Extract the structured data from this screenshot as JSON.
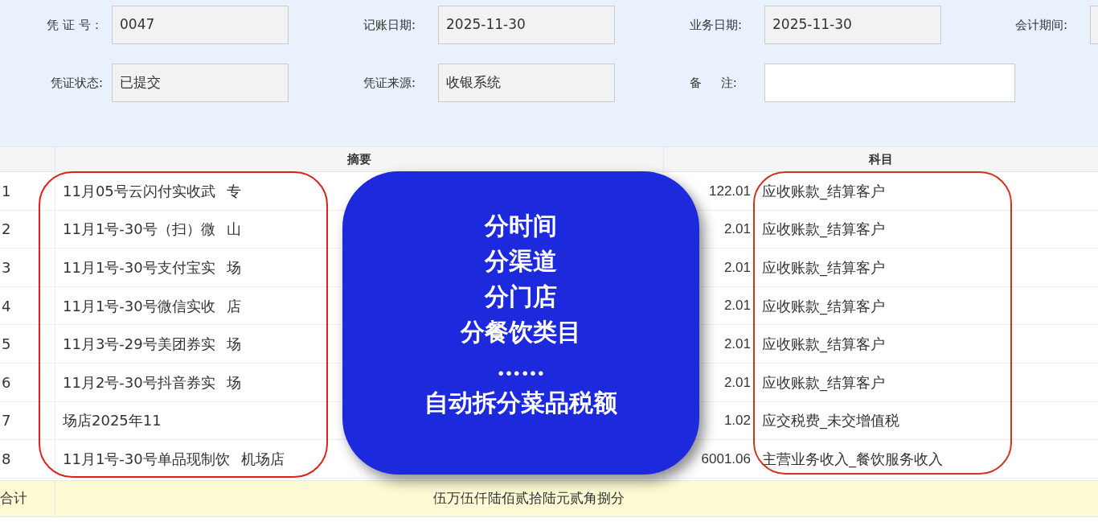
{
  "form": {
    "rows": [
      [
        {
          "label": "凭 证 号：",
          "value": "0047",
          "kind": "readonly"
        },
        {
          "label": "记账日期:",
          "value": "2025-11-30",
          "kind": "readonly"
        },
        {
          "label": "业务日期:",
          "value": "2025-11-30",
          "kind": "readonly"
        },
        {
          "label": "会计期间:",
          "kind": "readonly"
        }
      ],
      [
        {
          "label": "凭证状态:",
          "value": "已提交",
          "kind": "readonly"
        },
        {
          "label": "凭证来源:",
          "value": "收银系统",
          "kind": "readonly"
        },
        {
          "label": "备     注:",
          "kind": "editable"
        }
      ]
    ]
  },
  "table": {
    "columns": [
      "摘要",
      "科目"
    ],
    "rows": [
      {
        "index": "1",
        "summary": "11月05号云闪付实收武",
        "summary_tail": "专",
        "code": "122.01",
        "account": "应收账款_结算客户"
      },
      {
        "index": "2",
        "summary": "11月1号-30号（扫）微",
        "summary_tail": "山",
        "code": "2.01",
        "account": "应收账款_结算客户"
      },
      {
        "index": "3",
        "summary": "11月1号-30号支付宝实",
        "summary_tail": "场",
        "code": "2.01",
        "account": "应收账款_结算客户"
      },
      {
        "index": "4",
        "summary": "11月1号-30号微信实收",
        "summary_tail": "店",
        "code": "2.01",
        "account": "应收账款_结算客户"
      },
      {
        "index": "5",
        "summary": "11月3号-29号美团券实",
        "summary_tail": "场",
        "code": "2.01",
        "account": "应收账款_结算客户"
      },
      {
        "index": "6",
        "summary": "11月2号-30号抖音券实",
        "summary_tail": "场",
        "code": "2.01",
        "account": "应收账款_结算客户"
      },
      {
        "index": "7",
        "summary": "场店2025年11",
        "code": "1.02",
        "account": "应交税费_未交增值税"
      },
      {
        "index": "8",
        "summary": "11月1号-30号单品现制饮",
        "summary_tail": "机场店",
        "code": "6001.06",
        "account": "主营业务收入_餐饮服务收入"
      }
    ],
    "total": {
      "label": "合计",
      "value": "伍万伍仟陆佰贰拾陆元贰角捌分"
    }
  },
  "callout": {
    "lines": [
      "分时间",
      "分渠道",
      "分门店",
      "分餐饮类目",
      "……",
      "自动拆分菜品税额"
    ]
  }
}
